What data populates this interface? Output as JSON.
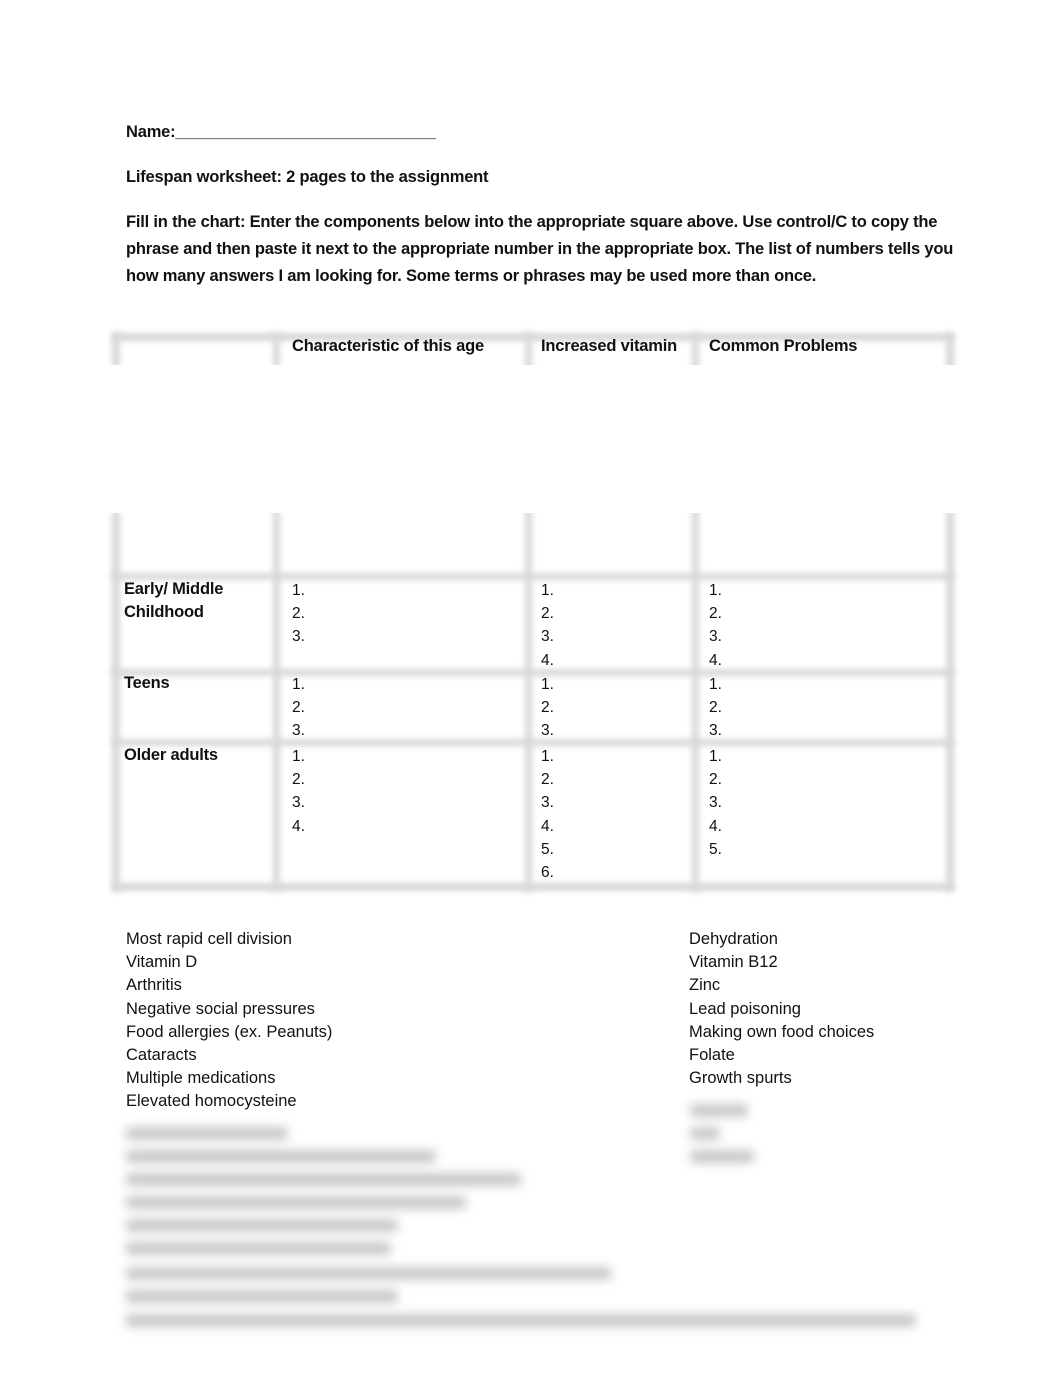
{
  "header": {
    "name_label": "Name:_____________________________",
    "subtitle": "Lifespan worksheet: 2 pages to the assignment",
    "instructions": "Fill in the chart: Enter the components below into the appropriate square above. Use control/C to copy the phrase and then paste it next to the appropriate number in the appropriate box. The list of numbers tells you how many answers I am looking for.  Some terms or phrases may be used more than once."
  },
  "table": {
    "columns": [
      "",
      "Characteristic of this age",
      "Increased vitamin",
      "Common Problems"
    ],
    "rows": [
      {
        "label": "Early/ Middle\nChildhood",
        "label_lines": [
          "Early/ Middle",
          "Childhood"
        ],
        "characteristic": [
          "1.",
          "2.",
          "3."
        ],
        "vitamin": [
          "1.",
          "2.",
          "3.",
          "4."
        ],
        "problems": [
          "1.",
          "2.",
          "3.",
          "4."
        ]
      },
      {
        "label": "Teens",
        "label_lines": [
          "Teens"
        ],
        "characteristic": [
          "1.",
          "2.",
          "3."
        ],
        "vitamin": [
          "1.",
          "2.",
          "3."
        ],
        "problems": [
          "1.",
          "2.",
          "3."
        ]
      },
      {
        "label": "Older adults",
        "label_lines": [
          "Older adults"
        ],
        "characteristic": [
          "1.",
          "2.",
          "3.",
          "4."
        ],
        "vitamin": [
          "1.",
          "2.",
          "3.",
          "4.",
          "5.",
          "6."
        ],
        "problems": [
          "1.",
          "2.",
          "3.",
          "4.",
          "5."
        ]
      }
    ]
  },
  "word_bank": {
    "left": [
      "Most rapid cell division",
      "Vitamin D",
      "Arthritis",
      "Negative social pressures",
      "Food allergies (ex. Peanuts)",
      "Cataracts",
      "Multiple medications",
      "Elevated homocysteine"
    ],
    "right": [
      "Dehydration",
      "Vitamin B12",
      "Zinc",
      "Lead poisoning",
      "Making own food choices",
      "Folate",
      "Growth spurts"
    ],
    "blurred_note": "remaining items obscured"
  }
}
